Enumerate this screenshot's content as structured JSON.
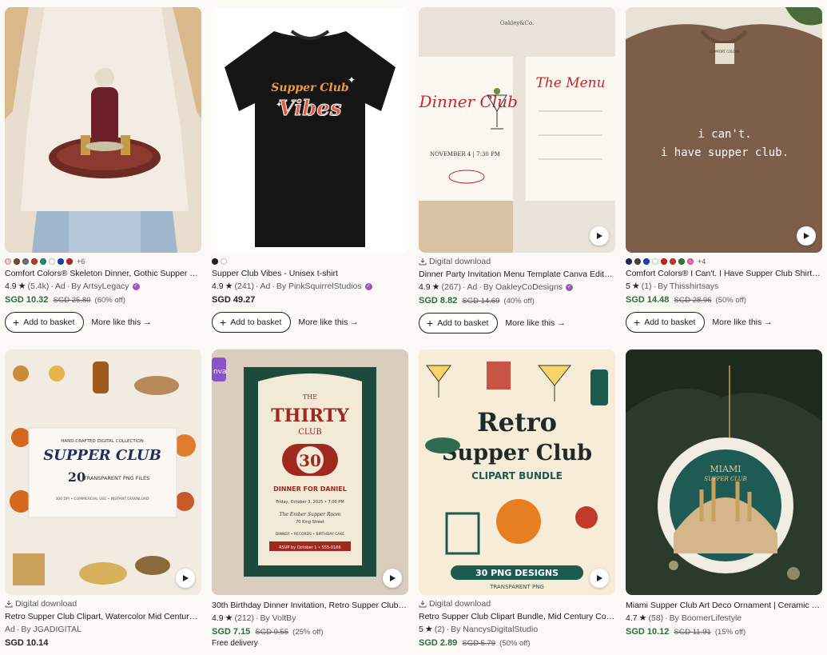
{
  "listings": [
    {
      "title": "Comfort Colors® Skeleton Dinner, Gothic Supper Club Shirt",
      "rating": "4.9",
      "reviews": "(5.4k)",
      "ad": "Ad",
      "seller": "By ArtsyLegacy",
      "price": "SGD 10.32",
      "old_price": "SGD 25.80",
      "discount": "(60% off)",
      "swatch_more": "+6",
      "swatches": [
        "#f4c9d0",
        "#7a4a3a",
        "#707070",
        "#c0392b",
        "#1e8c7a",
        "#ffffff",
        "#1f3fbf",
        "#d11d1d"
      ],
      "add_label": "Add to basket",
      "more_label": "More like this"
    },
    {
      "title": "Supper Club Vibes - Unisex t-shirt",
      "rating": "4.9",
      "reviews": "(241)",
      "ad": "Ad",
      "seller": "By PinkSquirrelStudios",
      "price": "SGD 49.27",
      "swatches": [
        "#222222",
        "#ffffff"
      ],
      "add_label": "Add to basket",
      "more_label": "More like this"
    },
    {
      "digital": "Digital download",
      "title": "Dinner Party Invitation Menu Template Canva Editable",
      "rating": "4.9",
      "reviews": "(267)",
      "ad": "Ad",
      "seller": "By OakleyCoDesigns",
      "price": "SGD 8.82",
      "old_price": "SGD 14.69",
      "discount": "(40% off)",
      "add_label": "Add to basket",
      "more_label": "More like this"
    },
    {
      "title": "Comfort Colors® I Can't. I Have Supper Club Shirt, Funny",
      "rating": "5",
      "reviews": "(1)",
      "seller": "By Thisshirtsays",
      "price": "SGD 14.48",
      "old_price": "SGD 28.96",
      "discount": "(50% off)",
      "swatch_more": "+4",
      "swatches": [
        "#1d2a5c",
        "#444444",
        "#1f3fbf",
        "#ffffff",
        "#d11d1d",
        "#c0392b",
        "#2e7d32",
        "#f06aa8"
      ],
      "add_label": "Add to basket",
      "more_label": "More like this"
    },
    {
      "digital": "Digital download",
      "title": "Retro Supper Club Clipart, Watercolor Mid Century Dinner",
      "ad_prefix": "Ad",
      "seller": "By JGADIGITAL",
      "price": "SGD 10.14"
    },
    {
      "title": "30th Birthday Dinner Invitation, Retro Supper Club Invitation",
      "rating": "4.9",
      "reviews": "(212)",
      "seller": "By VoltBy",
      "price": "SGD 7.15",
      "old_price": "SGD 9.55",
      "discount": "(25% off)",
      "free": "Free delivery",
      "canva_badge": "nva"
    },
    {
      "digital": "Digital download",
      "title": "Retro Supper Club Clipart Bundle, Mid Century Cocktail",
      "rating": "5",
      "reviews": "(2)",
      "seller": "By NancysDigitalStudio",
      "price": "SGD 2.89",
      "old_price": "SGD 5.79",
      "discount": "(50% off)"
    },
    {
      "title": "Miami Supper Club Art Deco Ornament | Ceramic Ornament",
      "rating": "4.7",
      "reviews": "(58)",
      "seller": "By BoomerLifestyle",
      "price": "SGD 10.12",
      "old_price": "SGD 11.91",
      "discount": "(15% off)"
    }
  ],
  "art": {
    "vibes_line1": "Supper Club",
    "vibes_line2": "Vibes",
    "oakley_brand": "Oakley&Co.",
    "dinner_title": "The Dinner Club",
    "menu_title": "The Menu",
    "invite_date": "NOVEMBER 4  |  7:30 PM",
    "tee_line1": "i can't.",
    "tee_line2": "i have supper club.",
    "tee_label": "COMFORT COLORS",
    "clip_small": "HAND-CRAFTED DIGITAL COLLECTION",
    "clip_title": "SUPPER CLUB",
    "clip_count": "20",
    "clip_files": "TRANSPARENT PNG FILES",
    "clip_info": "300 DPI • COMMERCIAL USE • INSTANT DOWNLOAD",
    "thirty_the": "THE",
    "thirty_title": "THIRTY",
    "thirty_club": "CLUB",
    "thirty_num": "30",
    "thirty_for": "DINNER FOR DANIEL",
    "thirty_date": "Friday, October 3, 2025 • 7:00 PM",
    "thirty_venue": "The Ember Supper Room",
    "thirty_street": "70 King Street",
    "thirty_list": "DINNER • RECORDS • BIRTHDAY CAKE",
    "thirty_rsvp": "RSVP by October 1 • 555-0166",
    "retro_1": "Retro",
    "retro_2": "Supper Club",
    "retro_3": "CLIPART BUNDLE",
    "retro_4": "30 PNG DESIGNS",
    "retro_5": "TRANSPARENT PNG",
    "miami_1": "MIAMI",
    "miami_2": "SUPPER CLUB"
  }
}
